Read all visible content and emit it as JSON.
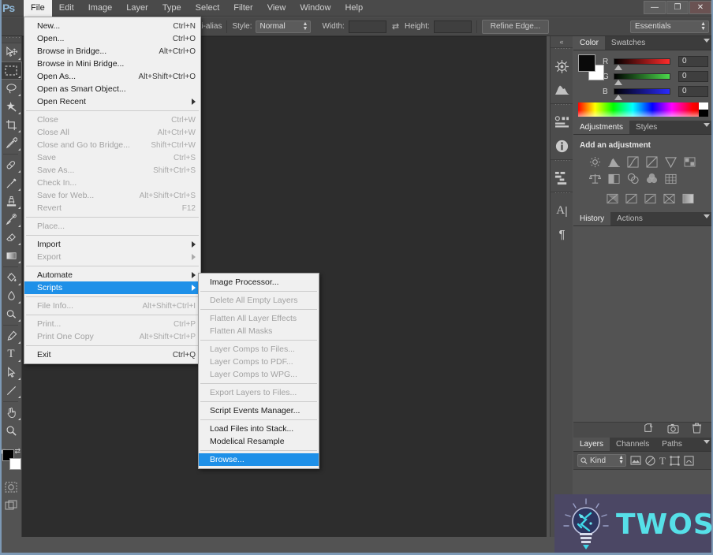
{
  "app": {
    "logo": "Ps",
    "workspace": "Essentials"
  },
  "window_controls": {
    "minimize": "—",
    "maximize": "❐",
    "close": "✕"
  },
  "menubar": {
    "items": [
      {
        "label": "File",
        "active": true
      },
      {
        "label": "Edit",
        "active": false
      },
      {
        "label": "Image",
        "active": false
      },
      {
        "label": "Layer",
        "active": false
      },
      {
        "label": "Type",
        "active": false
      },
      {
        "label": "Select",
        "active": false
      },
      {
        "label": "Filter",
        "active": false
      },
      {
        "label": "View",
        "active": false
      },
      {
        "label": "Window",
        "active": false
      },
      {
        "label": "Help",
        "active": false
      }
    ]
  },
  "options_bar": {
    "antialias_label": "nti-alias",
    "style_label": "Style:",
    "style_value": "Normal",
    "width_label": "Width:",
    "width_value": "",
    "height_label": "Height:",
    "height_value": "",
    "swap_icon": "swap-dimensions-icon",
    "refine_edge_label": "Refine Edge..."
  },
  "file_menu": {
    "items": [
      {
        "label": "New...",
        "shortcut": "Ctrl+N",
        "disabled": false
      },
      {
        "label": "Open...",
        "shortcut": "Ctrl+O",
        "disabled": false
      },
      {
        "label": "Browse in Bridge...",
        "shortcut": "Alt+Ctrl+O",
        "disabled": false
      },
      {
        "label": "Browse in Mini Bridge...",
        "shortcut": "",
        "disabled": false
      },
      {
        "label": "Open As...",
        "shortcut": "Alt+Shift+Ctrl+O",
        "disabled": false
      },
      {
        "label": "Open as Smart Object...",
        "shortcut": "",
        "disabled": false
      },
      {
        "label": "Open Recent",
        "shortcut": "",
        "disabled": false,
        "submenu": true
      },
      {
        "separator": true
      },
      {
        "label": "Close",
        "shortcut": "Ctrl+W",
        "disabled": true
      },
      {
        "label": "Close All",
        "shortcut": "Alt+Ctrl+W",
        "disabled": true
      },
      {
        "label": "Close and Go to Bridge...",
        "shortcut": "Shift+Ctrl+W",
        "disabled": true
      },
      {
        "label": "Save",
        "shortcut": "Ctrl+S",
        "disabled": true
      },
      {
        "label": "Save As...",
        "shortcut": "Shift+Ctrl+S",
        "disabled": true
      },
      {
        "label": "Check In...",
        "shortcut": "",
        "disabled": true
      },
      {
        "label": "Save for Web...",
        "shortcut": "Alt+Shift+Ctrl+S",
        "disabled": true
      },
      {
        "label": "Revert",
        "shortcut": "F12",
        "disabled": true
      },
      {
        "separator": true
      },
      {
        "label": "Place...",
        "shortcut": "",
        "disabled": true
      },
      {
        "separator": true
      },
      {
        "label": "Import",
        "shortcut": "",
        "disabled": false,
        "submenu": true
      },
      {
        "label": "Export",
        "shortcut": "",
        "disabled": true,
        "submenu": true
      },
      {
        "separator": true
      },
      {
        "label": "Automate",
        "shortcut": "",
        "disabled": false,
        "submenu": true
      },
      {
        "label": "Scripts",
        "shortcut": "",
        "disabled": false,
        "submenu": true,
        "highlight": true
      },
      {
        "separator": true
      },
      {
        "label": "File Info...",
        "shortcut": "Alt+Shift+Ctrl+I",
        "disabled": true
      },
      {
        "separator": true
      },
      {
        "label": "Print...",
        "shortcut": "Ctrl+P",
        "disabled": true
      },
      {
        "label": "Print One Copy",
        "shortcut": "Alt+Shift+Ctrl+P",
        "disabled": true
      },
      {
        "separator": true
      },
      {
        "label": "Exit",
        "shortcut": "Ctrl+Q",
        "disabled": false
      }
    ]
  },
  "scripts_menu": {
    "items": [
      {
        "label": "Image Processor...",
        "disabled": false
      },
      {
        "separator": true
      },
      {
        "label": "Delete All Empty Layers",
        "disabled": true
      },
      {
        "separator": true
      },
      {
        "label": "Flatten All Layer Effects",
        "disabled": true
      },
      {
        "label": "Flatten All Masks",
        "disabled": true
      },
      {
        "separator": true
      },
      {
        "label": "Layer Comps to Files...",
        "disabled": true
      },
      {
        "label": "Layer Comps to PDF...",
        "disabled": true
      },
      {
        "label": "Layer Comps to WPG...",
        "disabled": true
      },
      {
        "separator": true
      },
      {
        "label": "Export Layers to Files...",
        "disabled": true
      },
      {
        "separator": true
      },
      {
        "label": "Script Events Manager...",
        "disabled": false
      },
      {
        "separator": true
      },
      {
        "label": "Load Files into Stack...",
        "disabled": false
      },
      {
        "label": "Modelical Resample",
        "disabled": false
      },
      {
        "separator": true
      },
      {
        "label": "Browse...",
        "disabled": false,
        "highlight": true
      }
    ]
  },
  "toolbar": {
    "tools": [
      {
        "name": "move-tool",
        "selected": false
      },
      {
        "name": "rectangular-marquee-tool",
        "selected": true
      },
      {
        "name": "lasso-tool",
        "selected": false
      },
      {
        "name": "quick-selection-tool",
        "selected": false
      },
      {
        "name": "crop-tool",
        "selected": false
      },
      {
        "name": "eyedropper-tool",
        "selected": false
      },
      {
        "name": "spot-healing-brush-tool",
        "selected": false
      },
      {
        "name": "brush-tool",
        "selected": false
      },
      {
        "name": "clone-stamp-tool",
        "selected": false
      },
      {
        "name": "history-brush-tool",
        "selected": false
      },
      {
        "name": "eraser-tool",
        "selected": false
      },
      {
        "name": "gradient-tool",
        "selected": false
      },
      {
        "name": "blur-tool",
        "selected": false
      },
      {
        "name": "dodge-tool",
        "selected": false
      },
      {
        "name": "pen-tool",
        "selected": false
      },
      {
        "name": "horizontal-type-tool",
        "selected": false
      },
      {
        "name": "path-selection-tool",
        "selected": false
      },
      {
        "name": "line-shape-tool",
        "selected": false
      },
      {
        "name": "hand-tool",
        "selected": false
      },
      {
        "name": "zoom-tool",
        "selected": false
      }
    ],
    "foreground_color": "#000000",
    "background_color": "#ffffff",
    "quick_mask_name": "quick-mask-icon",
    "screen_mode_name": "screen-mode-icon"
  },
  "rail": {
    "collapse_label": "«",
    "icons": [
      {
        "name": "mini-bridge-icon"
      },
      {
        "name": "histogram-icon"
      },
      {
        "name": "measurement-log-icon"
      },
      {
        "name": "info-icon"
      },
      {
        "name": "tool-presets-icon"
      },
      {
        "name": "character-icon",
        "glyph": "A"
      },
      {
        "name": "paragraph-icon",
        "glyph": "¶"
      }
    ]
  },
  "color_panel": {
    "tabs": [
      {
        "label": "Color",
        "active": true
      },
      {
        "label": "Swatches",
        "active": false
      }
    ],
    "channels": [
      {
        "label": "R",
        "value": "0",
        "gradient_from": "#000000",
        "gradient_to": "#ff0000"
      },
      {
        "label": "G",
        "value": "0",
        "gradient_from": "#000000",
        "gradient_to": "#00ff00"
      },
      {
        "label": "B",
        "value": "0",
        "gradient_from": "#000000",
        "gradient_to": "#0000ff"
      }
    ],
    "foreground": "#000000",
    "background": "#ffffff"
  },
  "adjustments_panel": {
    "tabs": [
      {
        "label": "Adjustments",
        "active": true
      },
      {
        "label": "Styles",
        "active": false
      }
    ],
    "title": "Add an adjustment",
    "buttons": [
      {
        "name": "brightness-contrast-icon"
      },
      {
        "name": "levels-icon"
      },
      {
        "name": "curves-icon"
      },
      {
        "name": "exposure-icon"
      },
      {
        "name": "vibrance-icon"
      },
      {
        "name": "hue-saturation-icon"
      },
      {
        "name": "color-balance-icon"
      },
      {
        "name": "black-and-white-icon"
      },
      {
        "name": "photo-filter-icon"
      },
      {
        "name": "channel-mixer-icon"
      },
      {
        "name": "color-lookup-icon"
      },
      {
        "name": "invert-icon"
      },
      {
        "name": "posterize-icon"
      },
      {
        "name": "threshold-icon"
      },
      {
        "name": "selective-color-icon"
      },
      {
        "name": "gradient-map-icon"
      }
    ]
  },
  "history_panel": {
    "tabs": [
      {
        "label": "History",
        "active": true
      },
      {
        "label": "Actions",
        "active": false
      }
    ],
    "footer_icons": [
      {
        "name": "create-document-from-state-icon"
      },
      {
        "name": "create-snapshot-icon"
      },
      {
        "name": "delete-state-icon"
      }
    ]
  },
  "layers_panel": {
    "tabs": [
      {
        "label": "Layers",
        "active": true
      },
      {
        "label": "Channels",
        "active": false
      },
      {
        "label": "Paths",
        "active": false
      }
    ],
    "filter_label": "Kind",
    "filter_icons": [
      {
        "name": "search-icon"
      },
      {
        "name": "filter-pixel-layers-icon"
      },
      {
        "name": "filter-adjustment-layers-icon"
      },
      {
        "name": "filter-type-layers-icon"
      },
      {
        "name": "filter-shape-layers-icon"
      },
      {
        "name": "filter-smart-object-icon"
      }
    ]
  },
  "watermark": {
    "text": "TWOS",
    "icon_name": "lightbulb-icon",
    "bg_color": "#4b4764",
    "text_color": "#56e0e8"
  }
}
